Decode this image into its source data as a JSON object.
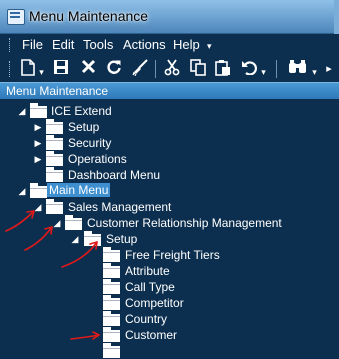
{
  "window": {
    "title": "Menu Maintenance"
  },
  "menubar": {
    "items": [
      {
        "label": "File"
      },
      {
        "label": "Edit"
      },
      {
        "label": "Tools"
      },
      {
        "label": "Actions"
      },
      {
        "label": "Help"
      }
    ],
    "overflow": "▾"
  },
  "toolbar": {
    "icons": [
      "new-document-icon",
      "save-icon",
      "delete-icon",
      "refresh-icon",
      "clean-icon",
      "cut-icon",
      "copy-icon",
      "paste-icon",
      "undo-icon",
      "find-icon"
    ]
  },
  "panel": {
    "title": "Menu Maintenance"
  },
  "tree": {
    "nodes": [
      {
        "label": "ICE Extend",
        "expander": "◢"
      },
      {
        "label": "Setup",
        "expander": "▶"
      },
      {
        "label": "Security",
        "expander": "▶"
      },
      {
        "label": "Operations",
        "expander": "▶"
      },
      {
        "label": "Dashboard Menu",
        "expander": ""
      },
      {
        "label": "Main Menu",
        "expander": "◢",
        "selected": true
      },
      {
        "label": "Sales Management",
        "expander": "◢"
      },
      {
        "label": "Customer Relationship Management",
        "expander": "◢"
      },
      {
        "label": "Setup",
        "expander": "◢"
      },
      {
        "label": "Free Freight Tiers",
        "expander": ""
      },
      {
        "label": "Attribute",
        "expander": ""
      },
      {
        "label": "Call Type",
        "expander": ""
      },
      {
        "label": "Competitor",
        "expander": ""
      },
      {
        "label": "Country",
        "expander": ""
      },
      {
        "label": "Customer",
        "expander": ""
      }
    ]
  },
  "colors": {
    "background": "#0d2f4f",
    "selection": "#3d8fd0",
    "annotation": "#e01a1a"
  }
}
